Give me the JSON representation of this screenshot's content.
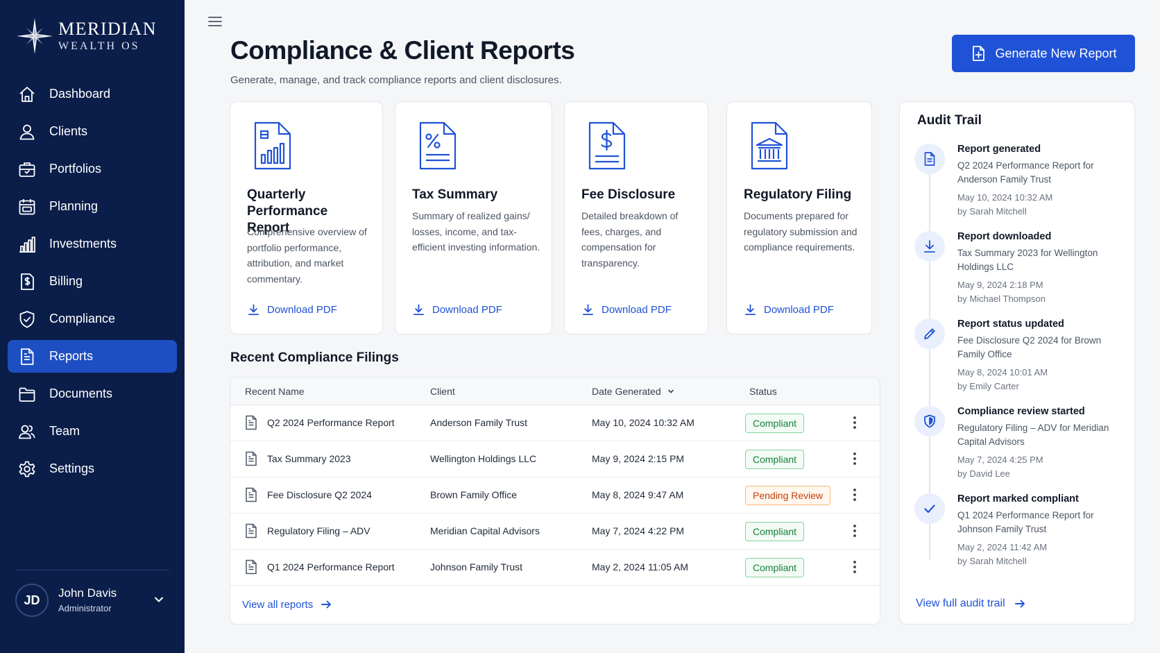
{
  "brand": {
    "name": "MERIDIAN",
    "sub": "WEALTH OS",
    "logo_icon": "compass-star-icon"
  },
  "sidebar": {
    "items": [
      {
        "label": "Dashboard",
        "icon": "home-icon"
      },
      {
        "label": "Clients",
        "icon": "user-icon"
      },
      {
        "label": "Portfolios",
        "icon": "briefcase-icon"
      },
      {
        "label": "Planning",
        "icon": "calendar-icon"
      },
      {
        "label": "Investments",
        "icon": "bar-chart-icon"
      },
      {
        "label": "Billing",
        "icon": "dollar-document-icon"
      },
      {
        "label": "Compliance",
        "icon": "shield-check-icon"
      },
      {
        "label": "Reports",
        "icon": "document-icon",
        "active": true
      },
      {
        "label": "Documents",
        "icon": "folder-icon"
      },
      {
        "label": "Team",
        "icon": "team-icon"
      },
      {
        "label": "Settings",
        "icon": "gear-icon"
      }
    ],
    "user": {
      "initials": "JD",
      "name": "John Davis",
      "role": "Administrator"
    }
  },
  "header": {
    "title": "Compliance & Client Reports",
    "subtitle": "Generate, manage, and track compliance reports and client disclosures.",
    "generate_button": "Generate New Report"
  },
  "cards": [
    {
      "title": "Quarterly Performance Report",
      "description": "Comprehensive overview of portfolio performance, attribution, and market commentary.",
      "link": "Download PDF",
      "icon": "report-chart-icon"
    },
    {
      "title": "Tax Summary",
      "description": "Summary of realized gains/ losses, income, and tax-efficient investing information.",
      "link": "Download PDF",
      "icon": "percent-document-icon"
    },
    {
      "title": "Fee Disclosure",
      "description": "Detailed breakdown of fees, charges, and compensation for transparency.",
      "link": "Download PDF",
      "icon": "dollar-document-icon"
    },
    {
      "title": "Regulatory Filing",
      "description": "Documents prepared for regulatory submission and compliance requirements.",
      "link": "Download PDF",
      "icon": "bank-document-icon"
    }
  ],
  "filings": {
    "title": "Recent Compliance Filings",
    "columns": [
      "Recent Name",
      "Client",
      "Date Generated",
      "Status"
    ],
    "rows": [
      {
        "name": "Q2 2024 Performance Report",
        "client": "Anderson Family Trust",
        "date": "May 10, 2024 10:32 AM",
        "status": "Compliant",
        "status_type": "ok"
      },
      {
        "name": "Tax Summary 2023",
        "client": "Wellington Holdings LLC",
        "date": "May 9, 2024 2:15 PM",
        "status": "Compliant",
        "status_type": "ok"
      },
      {
        "name": "Fee Disclosure Q2 2024",
        "client": "Brown Family Office",
        "date": "May 8, 2024 9:47 AM",
        "status": "Pending Review",
        "status_type": "pending"
      },
      {
        "name": "Regulatory Filing – ADV",
        "client": "Meridian Capital Advisors",
        "date": "May 7, 2024 4:22 PM",
        "status": "Compliant",
        "status_type": "ok"
      },
      {
        "name": "Q1 2024 Performance Report",
        "client": "Johnson Family Trust",
        "date": "May 2, 2024 11:05 AM",
        "status": "Compliant",
        "status_type": "ok"
      }
    ],
    "view_all": "View all reports"
  },
  "audit": {
    "title": "Audit Trail",
    "events": [
      {
        "title": "Report generated",
        "description": "Q2 2024 Performance Report for Anderson Family Trust",
        "time": "May 10, 2024 10:32 AM",
        "by": "by Sarah Mitchell",
        "icon": "document-icon"
      },
      {
        "title": "Report downloaded",
        "description": "Tax Summary 2023 for Wellington Holdings LLC",
        "time": "May 9, 2024 2:18 PM",
        "by": "by Michael Thompson",
        "icon": "download-icon"
      },
      {
        "title": "Report status updated",
        "description": "Fee Disclosure Q2 2024 for Brown Family Office",
        "time": "May 8, 2024 10:01 AM",
        "by": "by Emily Carter",
        "icon": "pencil-icon"
      },
      {
        "title": "Compliance review started",
        "description": "Regulatory Filing – ADV for Meridian Capital Advisors",
        "time": "May 7, 2024 4:25 PM",
        "by": "by David Lee",
        "icon": "shield-icon"
      },
      {
        "title": "Report marked compliant",
        "description": "Q1 2024 Performance Report for Johnson Family Trust",
        "time": "May 2, 2024 11:42 AM",
        "by": "by Sarah Mitchell",
        "icon": "check-icon"
      }
    ],
    "view_all": "View full audit trail"
  },
  "colors": {
    "sidebar": "#0b1e4a",
    "accent": "#1f52d6",
    "compliant": "#15803d",
    "pending": "#c2410c"
  }
}
